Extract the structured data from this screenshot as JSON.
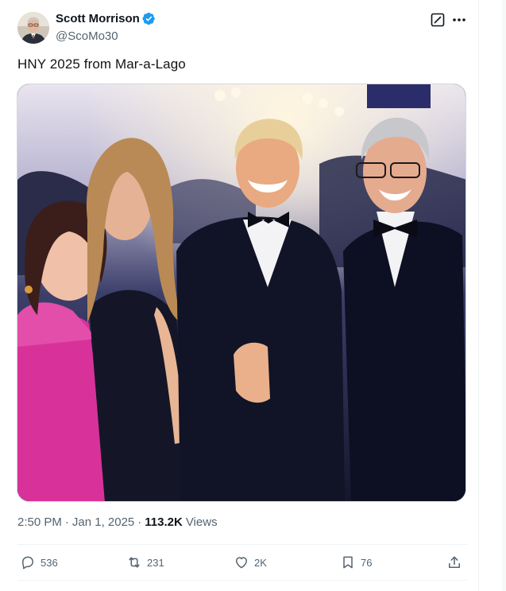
{
  "author": {
    "display_name": "Scott Morrison",
    "handle": "@ScoMo30",
    "verified": true,
    "avatar": "profile-photo"
  },
  "post": {
    "text": "HNY 2025 from Mar-a-Lago",
    "media": "event-photo"
  },
  "meta": {
    "time": "2:50 PM",
    "separator": "·",
    "date": "Jan 1, 2025",
    "separator2": "·",
    "views_count": "113.2K",
    "views_label": "Views"
  },
  "actions": {
    "replies": "536",
    "reposts": "231",
    "likes": "2K",
    "bookmarks": "76"
  },
  "icons": {
    "reply": "reply-icon",
    "repost": "repost-icon",
    "like": "heart-icon",
    "bookmark": "bookmark-icon",
    "share": "share-icon",
    "grok": "grok-icon",
    "more": "more-icon",
    "verified": "verified-badge-icon"
  },
  "colors": {
    "text_primary": "#0f1419",
    "text_secondary": "#536471",
    "verified_blue": "#1d9bf0",
    "divider": "#eff3f4"
  }
}
